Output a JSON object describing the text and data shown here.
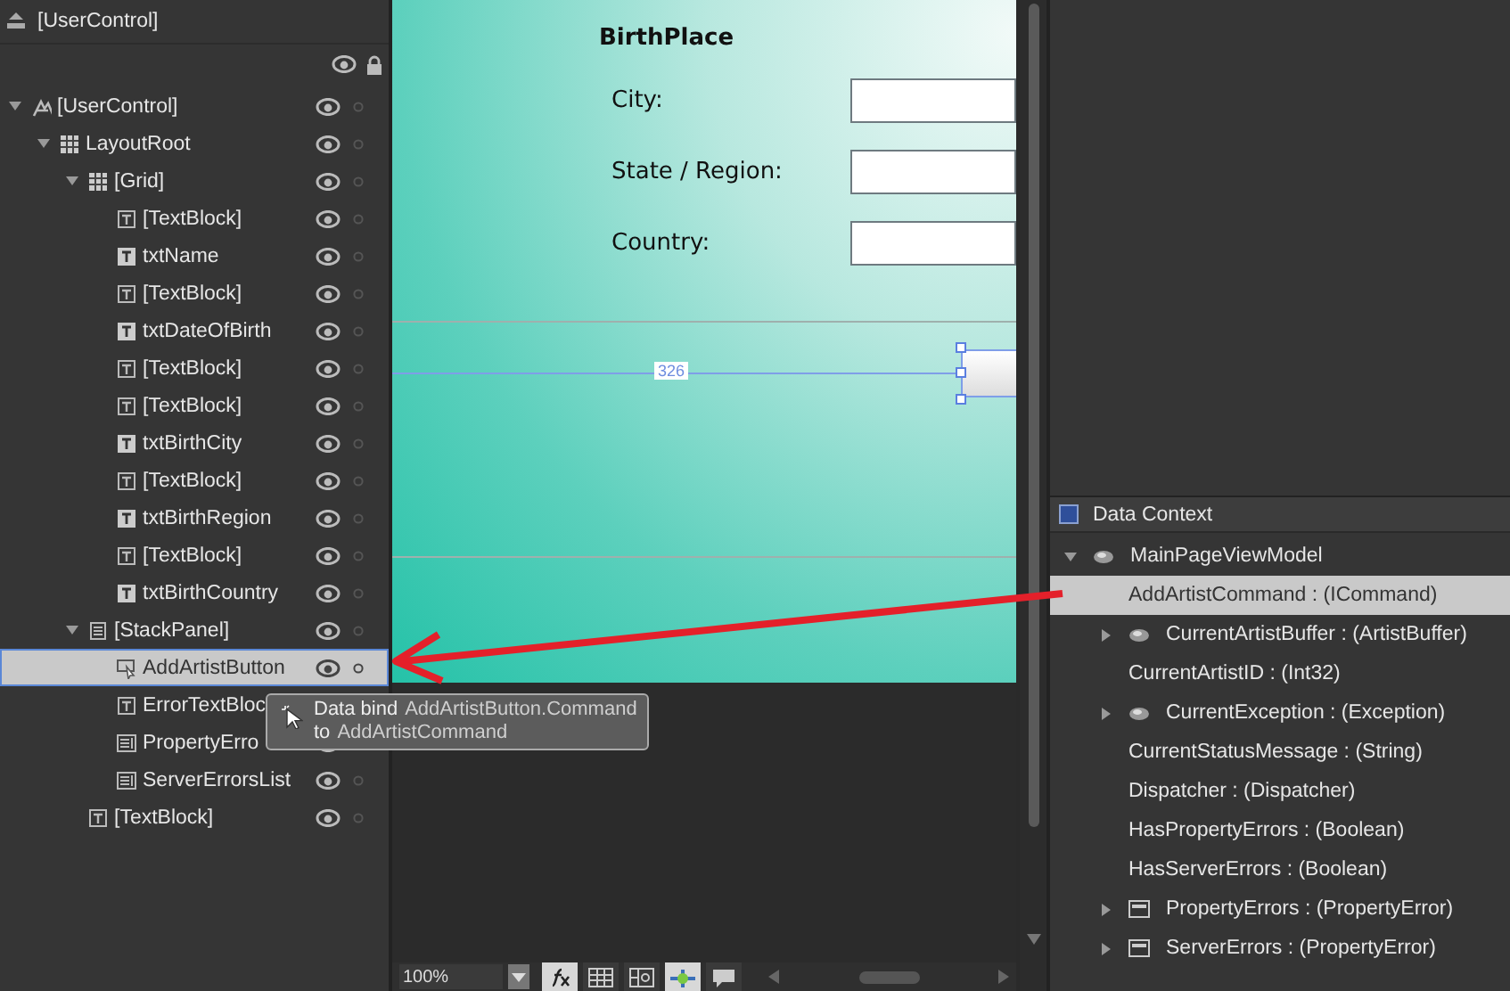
{
  "objects_panel": {
    "scope_title": "[UserControl]",
    "tree": [
      {
        "label": "[UserControl]",
        "kind": "usercontrol",
        "expanded": true,
        "selected": false,
        "children": [
          {
            "label": "LayoutRoot",
            "kind": "grid",
            "expanded": true,
            "selected": false,
            "children": [
              {
                "label": "[Grid]",
                "kind": "grid",
                "expanded": true,
                "selected": false,
                "children": [
                  {
                    "label": "[TextBlock]",
                    "kind": "textblock",
                    "selected": false
                  },
                  {
                    "label": "txtName",
                    "kind": "textbox",
                    "selected": false
                  },
                  {
                    "label": "[TextBlock]",
                    "kind": "textblock",
                    "selected": false
                  },
                  {
                    "label": "txtDateOfBirth",
                    "kind": "textbox",
                    "selected": false
                  },
                  {
                    "label": "[TextBlock]",
                    "kind": "textblock",
                    "selected": false
                  },
                  {
                    "label": "[TextBlock]",
                    "kind": "textblock",
                    "selected": false
                  },
                  {
                    "label": "txtBirthCity",
                    "kind": "textbox",
                    "selected": false
                  },
                  {
                    "label": "[TextBlock]",
                    "kind": "textblock",
                    "selected": false
                  },
                  {
                    "label": "txtBirthRegion",
                    "kind": "textbox",
                    "selected": false
                  },
                  {
                    "label": "[TextBlock]",
                    "kind": "textblock",
                    "selected": false
                  },
                  {
                    "label": "txtBirthCountry",
                    "kind": "textbox",
                    "selected": false
                  }
                ]
              },
              {
                "label": "[StackPanel]",
                "kind": "stackpanel",
                "expanded": true,
                "selected": false,
                "children": [
                  {
                    "label": "AddArtistButton",
                    "kind": "button",
                    "selected": true
                  },
                  {
                    "label": "ErrorTextBloc",
                    "kind": "textblock",
                    "selected": false
                  },
                  {
                    "label": "PropertyErro",
                    "kind": "listbox",
                    "selected": false
                  },
                  {
                    "label": "ServerErrorsList",
                    "kind": "listbox",
                    "selected": false
                  }
                ]
              },
              {
                "label": "[TextBlock]",
                "kind": "textblock",
                "selected": false
              }
            ]
          }
        ]
      }
    ]
  },
  "artboard": {
    "title": "BirthPlace",
    "fields": [
      {
        "label": "City:"
      },
      {
        "label": "State / Region:"
      },
      {
        "label": "Country:"
      }
    ],
    "measurement": "326"
  },
  "tooltip": {
    "lines": [
      {
        "label": "Data bind",
        "value": "AddArtistButton.Command"
      },
      {
        "label": "to",
        "value": "AddArtistCommand"
      }
    ]
  },
  "toolbar": {
    "zoom": "100%"
  },
  "data_context": {
    "title": "Data Context",
    "tree": [
      {
        "label": "MainPageViewModel",
        "kind": "object",
        "expanded": true,
        "selected": false,
        "children": [
          {
            "label": "AddArtistCommand : (ICommand)",
            "selected": true
          },
          {
            "label": "CurrentArtistBuffer : (ArtistBuffer)",
            "kind": "object",
            "expanded": false,
            "selected": false
          },
          {
            "label": "CurrentArtistID : (Int32)",
            "selected": false
          },
          {
            "label": "CurrentException : (Exception)",
            "kind": "object",
            "expanded": false,
            "selected": false
          },
          {
            "label": "CurrentStatusMessage : (String)",
            "selected": false
          },
          {
            "label": "Dispatcher : (Dispatcher)",
            "selected": false
          },
          {
            "label": "HasPropertyErrors : (Boolean)",
            "selected": false
          },
          {
            "label": "HasServerErrors : (Boolean)",
            "selected": false
          },
          {
            "label": "PropertyErrors : (PropertyError)",
            "kind": "collection",
            "expanded": false,
            "selected": false
          },
          {
            "label": "ServerErrors : (PropertyError)",
            "kind": "collection",
            "expanded": false,
            "selected": false
          }
        ]
      }
    ]
  }
}
